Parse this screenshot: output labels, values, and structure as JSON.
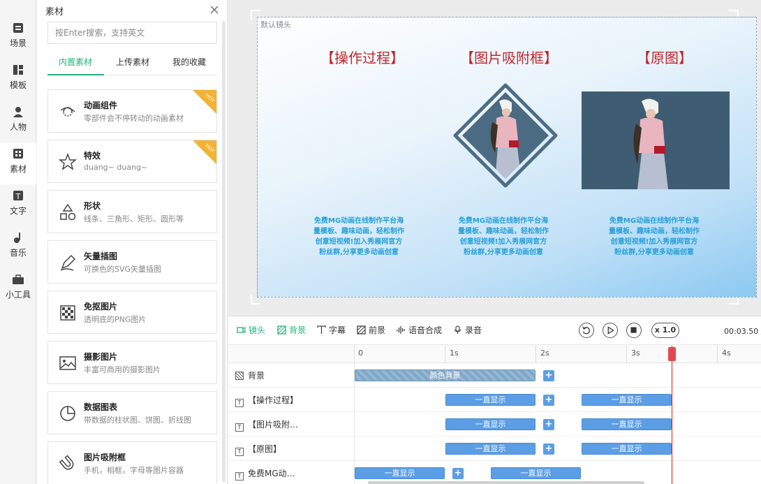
{
  "rail": [
    {
      "label": "场景",
      "icon": "scene-icon"
    },
    {
      "label": "模板",
      "icon": "template-icon"
    },
    {
      "label": "人物",
      "icon": "person-icon"
    },
    {
      "label": "素材",
      "icon": "material-icon",
      "active": true
    },
    {
      "label": "文字",
      "icon": "text-icon"
    },
    {
      "label": "音乐",
      "icon": "music-icon"
    },
    {
      "label": "小工具",
      "icon": "toolbox-icon"
    }
  ],
  "panel": {
    "title": "素材",
    "search_placeholder": "按Enter搜索，支持英文",
    "tabs": [
      "内置素材",
      "上传素材",
      "我的收藏"
    ],
    "hot_label": "HOT",
    "cards": [
      {
        "title": "动画组件",
        "subtitle": "零部件会不停转动的动画素材",
        "hot": true
      },
      {
        "title": "特效",
        "subtitle": "duang~ duang~",
        "hot": true
      },
      {
        "title": "形状",
        "subtitle": "线条、三角形、矩形、圆形等"
      },
      {
        "title": "矢量插图",
        "subtitle": "可换色的SVG矢量插图"
      },
      {
        "title": "免抠图片",
        "subtitle": "透明底的PNG图片"
      },
      {
        "title": "摄影图片",
        "subtitle": "丰富可商用的摄影图片"
      },
      {
        "title": "数据图表",
        "subtitle": "带数据的柱状图、饼图、折线图"
      },
      {
        "title": "图片吸附框",
        "subtitle": "手机，相框，字母等图片容器"
      }
    ]
  },
  "stage": {
    "label": "默认镜头",
    "headings": [
      "【操作过程】",
      "【图片吸附框】",
      "【原图】"
    ],
    "desc_lines": [
      "免费MG动画在线制作平台海",
      "量模板、趣味动画，轻松制作",
      "创意短视频!加入秀展网官方",
      "粉丝群,分享更多动画创意"
    ],
    "heading_color": "#c0262b",
    "desc_color": "#27a0d8"
  },
  "timeline": {
    "tools": [
      "镜头",
      "背景",
      "字幕",
      "前景",
      "语音合成",
      "录音"
    ],
    "active_tool": "背景",
    "speed": "x 1.0",
    "timecode": "00:03.50 /",
    "ticks": [
      "0",
      "1s",
      "2s",
      "3s",
      "4s"
    ],
    "tracks": [
      {
        "label": "背景",
        "clips": [
          "颜色背景"
        ]
      },
      {
        "label": "【操作过程】",
        "clips": [
          "一直显示",
          "一直显示"
        ]
      },
      {
        "label": "【图片吸附…",
        "clips": [
          "一直显示",
          "一直显示"
        ]
      },
      {
        "label": "【原图】",
        "clips": [
          "一直显示",
          "一直显示"
        ]
      },
      {
        "label": "免费MG动…",
        "clips": [
          "一直显示",
          "一直显示"
        ]
      }
    ],
    "playhead_seconds": 3.5,
    "accent": "#26b37c",
    "clip_color": "#5b9ee5"
  }
}
